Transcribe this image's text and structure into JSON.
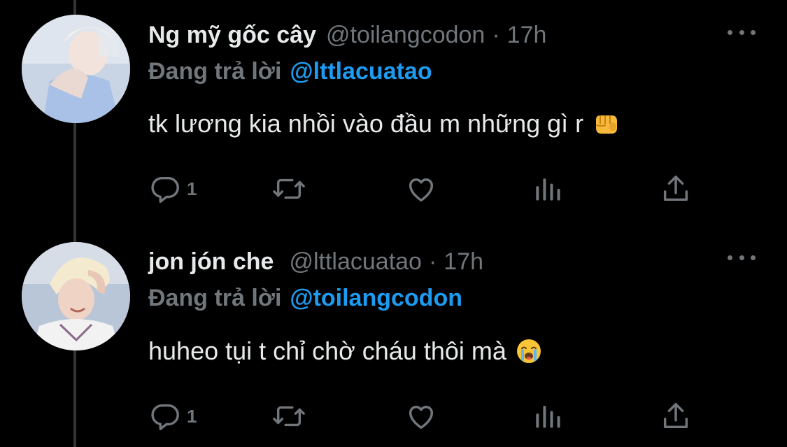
{
  "tweets": [
    {
      "display_name": "Ng mỹ gốc cây",
      "handle": "@toilangcodon",
      "separator": "·",
      "time": "17h",
      "reply_prefix": "Đang trả lời",
      "reply_to": "@lttlacuatao",
      "text": "tk lương kia nhồi vào đầu m những gì r",
      "emoji": "oncoming-fist-emoji",
      "reply_count": "1"
    },
    {
      "display_name": "jon jón che",
      "handle": "@lttlacuatao",
      "separator": "·",
      "time": "17h",
      "reply_prefix": "Đang trả lời",
      "reply_to": "@toilangcodon",
      "text": "huheo tụi t chỉ chờ cháu thôi mà",
      "emoji": "loudly-crying-face-emoji",
      "reply_count": "1"
    }
  ],
  "colors": {
    "background": "#000000",
    "text": "#e7e9ea",
    "muted": "#71767b",
    "accent": "#1d9bf0",
    "thread_line": "#333639"
  },
  "icons": [
    "reply-icon",
    "retweet-icon",
    "like-icon",
    "analytics-icon",
    "share-icon",
    "more-icon"
  ]
}
